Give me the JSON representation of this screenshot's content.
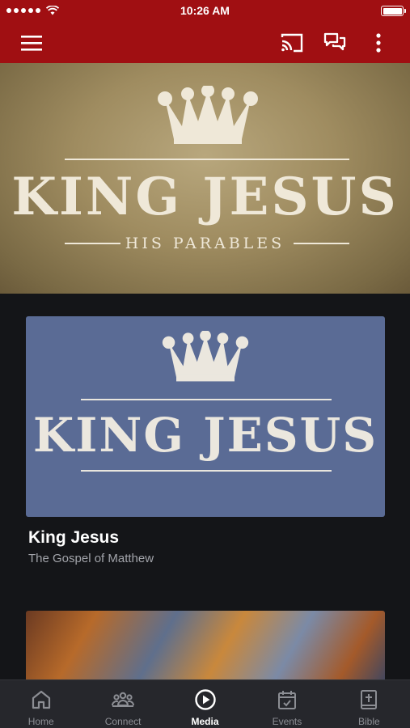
{
  "status_bar": {
    "time": "10:26 AM"
  },
  "app_bar": {
    "menu_icon": "hamburger-menu-icon",
    "cast_icon": "cast-icon",
    "chat_icon": "chat-icon",
    "more_icon": "more-vertical-icon",
    "color": "#a00f12"
  },
  "hero": {
    "title": "KING JESUS",
    "subtitle": "HIS PARABLES"
  },
  "series": {
    "card_title": "KING JESUS",
    "title": "King Jesus",
    "subtitle": "The Gospel of Matthew"
  },
  "tabs": [
    {
      "label": "Home",
      "icon": "home-icon",
      "active": false
    },
    {
      "label": "Connect",
      "icon": "group-icon",
      "active": false
    },
    {
      "label": "Media",
      "icon": "play-circle-icon",
      "active": true
    },
    {
      "label": "Events",
      "icon": "calendar-icon",
      "active": false
    },
    {
      "label": "Bible",
      "icon": "bible-icon",
      "active": false
    }
  ]
}
